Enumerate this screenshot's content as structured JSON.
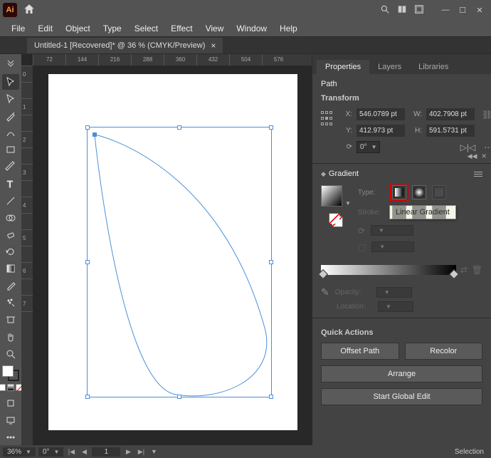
{
  "titlebar": {
    "logo_text": "Ai"
  },
  "menubar": [
    "File",
    "Edit",
    "Object",
    "Type",
    "Select",
    "Effect",
    "View",
    "Window",
    "Help"
  ],
  "document_tab": {
    "title": "Untitled-1 [Recovered]* @ 36 % (CMYK/Preview)"
  },
  "ruler_h": [
    "72",
    "144",
    "216",
    "288",
    "360",
    "432",
    "504",
    "576"
  ],
  "ruler_v": [
    "72",
    "0",
    "72",
    "1",
    "4",
    "4",
    "2",
    "1",
    "6",
    "2",
    "8",
    "8",
    "3",
    "6",
    "0",
    "4",
    "3",
    "2",
    "5",
    "0",
    "4",
    "5",
    "7",
    "6"
  ],
  "panels": {
    "tabs": {
      "properties": "Properties",
      "layers": "Layers",
      "libraries": "Libraries"
    },
    "object_type": "Path",
    "transform": {
      "heading": "Transform",
      "x_label": "X:",
      "x_value": "546.0789 pt",
      "y_label": "Y:",
      "y_value": "412.973 pt",
      "w_label": "W:",
      "w_value": "402.7908 pt",
      "h_label": "H:",
      "h_value": "591.5731 pt",
      "rotate_value": "0°"
    },
    "gradient": {
      "title": "Gradient",
      "type_label": "Type:",
      "stroke_label": "Stroke:",
      "tooltip": "Linear Gradient",
      "opacity_label": "Opacity:",
      "location_label": "Location:"
    },
    "quick_actions": {
      "heading": "Quick Actions",
      "offset_path": "Offset Path",
      "recolor": "Recolor",
      "arrange": "Arrange",
      "start_global_edit": "Start Global Edit"
    }
  },
  "statusbar": {
    "zoom": "36%",
    "rotate": "0°",
    "artboard": "1",
    "mode": "Selection"
  }
}
